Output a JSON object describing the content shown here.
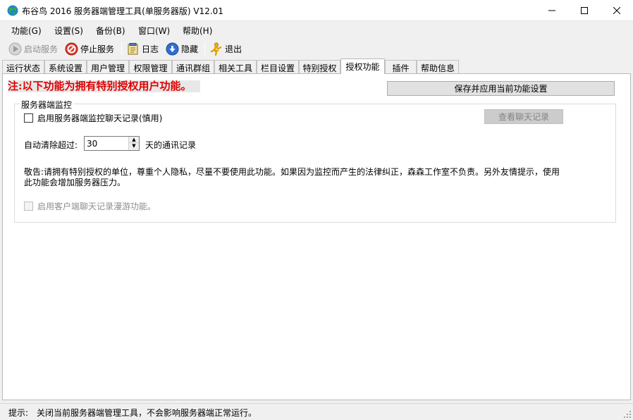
{
  "window": {
    "title": "布谷鸟 2016 服务器端管理工具(单服务器版)  V12.01",
    "controls": {
      "minimize": "—",
      "maximize": "☐",
      "close": "✕"
    }
  },
  "menu": {
    "function": "功能(G)",
    "settings": "设置(S)",
    "backup": "备份(B)",
    "window": "窗口(W)",
    "help": "帮助(H)"
  },
  "toolbar": {
    "start_service": "启动服务",
    "stop_service": "停止服务",
    "log": "日志",
    "hide": "隐藏",
    "exit": "退出",
    "icons": [
      "play-icon",
      "stop-icon",
      "log-book-icon",
      "hide-down-icon",
      "exit-figure-icon"
    ]
  },
  "tabs": [
    "运行状态",
    "系统设置",
    "用户管理",
    "权限管理",
    "通讯群组",
    "相关工具",
    "栏目设置",
    "特别授权",
    "授权功能",
    "插件",
    "帮助信息"
  ],
  "active_tab": "授权功能",
  "panel": {
    "notice": "注:以下功能为拥有特别授权用户功能。",
    "save_button": "保存并应用当前功能设置",
    "group_title": "服务器端监控",
    "enable_monitor_label": "启用服务器端监控聊天记录(慎用)",
    "enable_monitor_checked": false,
    "view_chat_button": "查看聊天记录",
    "auto_clear_label": "自动清除超过:",
    "auto_clear_value": "30",
    "auto_clear_suffix": "天的通讯记录",
    "warning_line1": "敬告:请拥有特别授权的单位，尊重个人隐私，尽量不要使用此功能。如果因为监控而产生的法律纠正，森森工作室不负责。另外友情提示，使用",
    "warning_line2": "此功能会增加服务器压力。",
    "roaming_label": "启用客户端聊天记录漫游功能。",
    "roaming_checked": false
  },
  "status": {
    "label": "提示:",
    "text": "关闭当前服务器端管理工具，不会影响服务器端正常运行。"
  },
  "colors": {
    "notice_red": "#e00000",
    "window_bg": "#f0f0f0",
    "panel_bg": "#ffffff"
  }
}
